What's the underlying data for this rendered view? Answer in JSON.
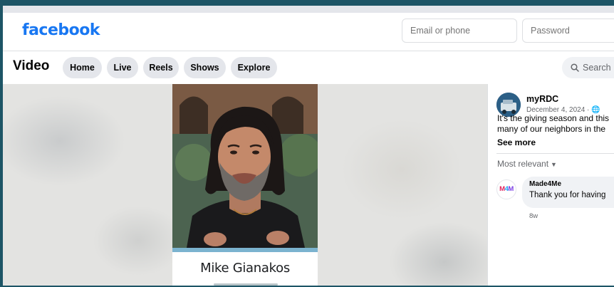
{
  "header": {
    "logo": "facebook",
    "email_placeholder": "Email or phone",
    "password_placeholder": "Password"
  },
  "video_nav": {
    "title": "Video",
    "tabs": [
      {
        "label": "Home"
      },
      {
        "label": "Live"
      },
      {
        "label": "Reels"
      },
      {
        "label": "Shows"
      },
      {
        "label": "Explore"
      }
    ],
    "search_label": "Search"
  },
  "video": {
    "caption_name": "Mike Gianakos"
  },
  "post": {
    "author": "myRDC",
    "date": "December 4, 2024 ·",
    "text_line1": "It's the giving season and this",
    "text_line2": "many of our neighbors in the",
    "see_more": "See more"
  },
  "comments": {
    "sort_label": "Most relevant",
    "items": [
      {
        "author": "Made4Me",
        "text": "Thank you for having",
        "time": "8w",
        "avatar_text": "M4M"
      }
    ]
  },
  "colors": {
    "brand_blue": "#1877f2",
    "outer_background": "#1d5566",
    "pill_background": "#e4e6eb"
  }
}
